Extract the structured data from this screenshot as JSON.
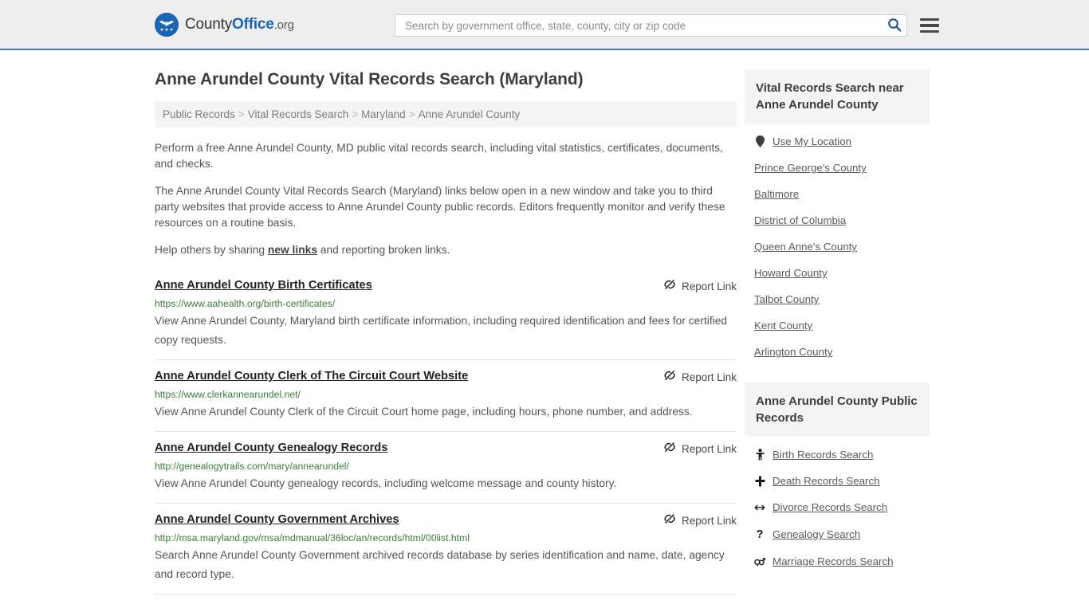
{
  "header": {
    "logo": {
      "icon": "eagle-seal-icon",
      "text_part1": "County",
      "text_part2": "Office",
      "text_part3": ".org"
    },
    "search": {
      "placeholder": "Search by government office, state, county, city or zip code",
      "value": "",
      "icon": "search-icon"
    },
    "menu_icon": "hamburger-menu-icon",
    "accent_color": "#4a7aab"
  },
  "main": {
    "title": "Anne Arundel County Vital Records Search (Maryland)",
    "breadcrumb": [
      "Public Records",
      "Vital Records Search",
      "Maryland",
      "Anne Arundel County"
    ],
    "breadcrumb_separator": ">",
    "intro": {
      "p1": "Perform a free Anne Arundel County, MD public vital records search, including vital statistics, certificates, documents, and checks.",
      "p2": "The Anne Arundel County Vital Records Search (Maryland) links below open in a new window and take you to third party websites that provide access to Anne Arundel County public records. Editors frequently monitor and verify these resources on a routine basis.",
      "p3_before": "Help others by sharing ",
      "p3_link": "new links",
      "p3_after": " and reporting broken links."
    },
    "report_link_label": "Report Link",
    "report_link_icon": "broken-link-icon",
    "results": [
      {
        "title": "Anne Arundel County Birth Certificates",
        "url": "https://www.aahealth.org/birth-certificates/",
        "description": "View Anne Arundel County, Maryland birth certificate information, including required identification and fees for certified copy requests."
      },
      {
        "title": "Anne Arundel County Clerk of The Circuit Court Website",
        "url": "https://www.clerkannearundel.net/",
        "description": "View Anne Arundel County Clerk of the Circuit Court home page, including hours, phone number, and address."
      },
      {
        "title": "Anne Arundel County Genealogy Records",
        "url": "http://genealogytrails.com/mary/annearundel/",
        "description": "View Anne Arundel County genealogy records, including welcome message and county history."
      },
      {
        "title": "Anne Arundel County Government Archives",
        "url": "http://msa.maryland.gov/msa/mdmanual/36loc/an/records/html/00list.html",
        "description": "Search Anne Arundel County Government archived records database by series identification and name, date, agency and record type."
      }
    ]
  },
  "sidebar": {
    "nearby": {
      "title": "Vital Records Search near Anne Arundel County",
      "items": [
        {
          "label": "Use My Location",
          "icon": "map-pin-icon"
        },
        {
          "label": "Prince George's County",
          "icon": ""
        },
        {
          "label": "Baltimore",
          "icon": ""
        },
        {
          "label": "District of Columbia",
          "icon": ""
        },
        {
          "label": "Queen Anne's County",
          "icon": ""
        },
        {
          "label": "Howard County",
          "icon": ""
        },
        {
          "label": "Talbot County",
          "icon": ""
        },
        {
          "label": "Kent County",
          "icon": ""
        },
        {
          "label": "Arlington County",
          "icon": ""
        }
      ]
    },
    "public_records": {
      "title": "Anne Arundel County Public Records",
      "items": [
        {
          "label": "Birth Records Search",
          "icon": "baby-icon"
        },
        {
          "label": "Death Records Search",
          "icon": "cross-icon"
        },
        {
          "label": "Divorce Records Search",
          "icon": "split-arrow-icon"
        },
        {
          "label": "Genealogy Search",
          "icon": "question-mark-icon"
        },
        {
          "label": "Marriage Records Search",
          "icon": "gender-symbols-icon"
        }
      ]
    }
  }
}
